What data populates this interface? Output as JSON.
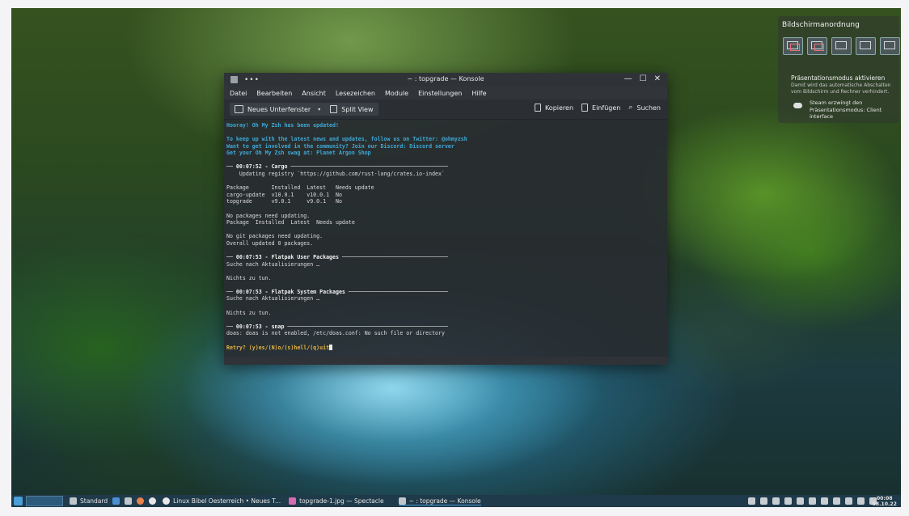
{
  "konsole": {
    "window_title": "~ : topgrade — Konsole",
    "title_dots": "•••",
    "controls": {
      "minimize": "—",
      "maximize": "☐",
      "close": "✕"
    },
    "menu": [
      "Datei",
      "Bearbeiten",
      "Ansicht",
      "Lesezeichen",
      "Module",
      "Einstellungen",
      "Hilfe"
    ],
    "toolbar": {
      "new_tab": "Neues Unterfenster",
      "split_view": "Split View",
      "copy": "Kopieren",
      "paste": "Einfügen",
      "search": "Suchen"
    },
    "terminal": {
      "l01": "Hooray! Oh My Zsh has been updated!",
      "l02": "To keep up with the latest news and updates, follow us on Twitter: @ohmyzsh",
      "l03": "Want to get involved in the community? Join our Discord: Discord server",
      "l04": "Get your Oh My Zsh swag at: Planet Argon Shop",
      "l05": "── 00:07:52 - Cargo ─────────────────────────────────────────────────",
      "l06": "    Updating registry `https://github.com/rust-lang/crates.io-index`",
      "l07": "Package       Installed  Latest   Needs update",
      "l08": "cargo-update  v10.0.1    v10.0.1  No",
      "l09": "topgrade      v9.0.1     v9.0.1   No",
      "l10": "No packages need updating.",
      "l11": "Package  Installed  Latest  Needs update",
      "l12": "No git packages need updating.",
      "l13": "Overall updated 0 packages.",
      "l14": "── 00:07:53 - Flatpak User Packages ─────────────────────────────────",
      "l15": "Suche nach Aktualisierungen …",
      "l16": "Nichts zu tun.",
      "l17": "── 00:07:53 - Flatpak System Packages ───────────────────────────────",
      "l18": "Suche nach Aktualisierungen …",
      "l19": "Nichts zu tun.",
      "l20": "── 00:07:53 - snap ──────────────────────────────────────────────────",
      "l21": "doas: doas is not enabled, /etc/doas.conf: No such file or directory",
      "l22": "Retry? (y)es/(N)o/(s)hell/(q)uit"
    }
  },
  "display_popup": {
    "title": "Bildschirmanordnung",
    "presentation_heading": "Präsentationsmodus aktivieren",
    "presentation_desc": "Damit wird das automatische Abschalten\nvom Bildschirm und Rechner verhindert.",
    "steam_text": "Steam erzwingt den\nPräsentationsmodus: Client\ninterface"
  },
  "taskbar": {
    "activity": "Standard",
    "tasks": [
      "Linux Bibel Oesterreich • Neues T...",
      "topgrade-1.jpg — Spectacle",
      "~ : topgrade — Konsole"
    ],
    "clock_time": "00:08",
    "clock_date": "08.10.22"
  }
}
